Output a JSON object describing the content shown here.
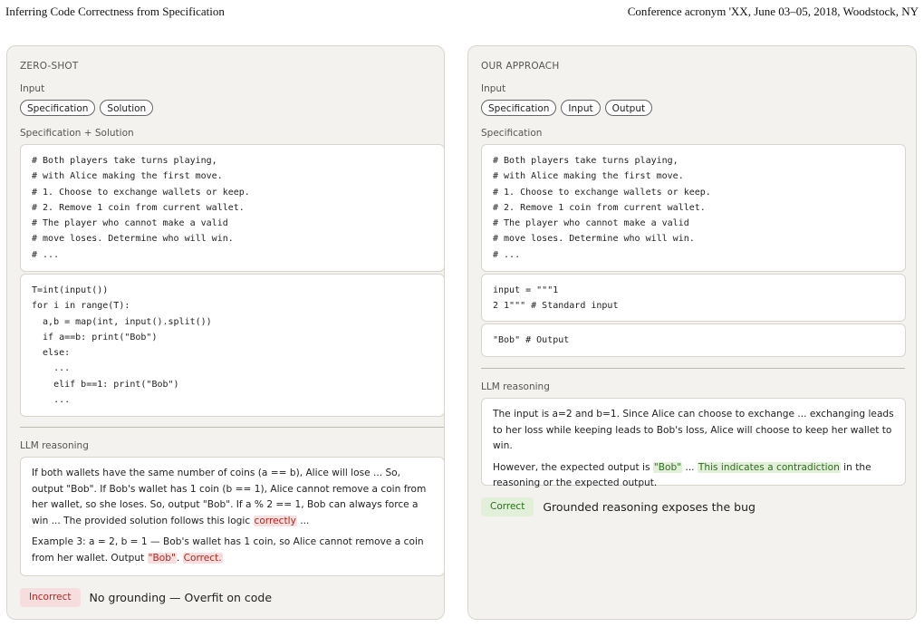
{
  "header": {
    "left": "Inferring Code Correctness from Specification",
    "right": "Conference acronym 'XX, June 03–05, 2018, Woodstock, NY"
  },
  "zero_shot": {
    "title": "ZERO-SHOT",
    "input_label": "Input",
    "pills": [
      "Specification",
      "Solution"
    ],
    "spec_label": "Specification + Solution",
    "spec_code": "# Both players take turns playing,\n# with Alice making the first move.\n# 1. Choose to exchange wallets or keep.\n# 2. Remove 1 coin from current wallet.\n# The player who cannot make a valid\n# move loses. Determine who will win.\n# ...",
    "solution_code": "T=int(input())\nfor i in range(T):\n  a,b = map(int, input().split())\n  if a==b: print(\"Bob\")\n  else:\n    ...\n    elif b==1: print(\"Bob\")\n    ...",
    "reasoning_label": "LLM reasoning",
    "reasoning_p1_a": "If both wallets have the same number of coins (a == b), Alice will lose ... So, output \"Bob\". If Bob's wallet has 1 coin (b == 1), Alice cannot remove a coin from her wallet, so she loses. So, output \"Bob\". If a % 2 == 1, Bob can always force a win ... The provided solution follows this logic ",
    "reasoning_p1_hl": "correctly",
    "reasoning_p1_b": " ...",
    "reasoning_p2_a": "Example 3: a = 2, b = 1 — Bob's wallet has 1 coin, so Alice cannot remove a coin from her wallet. Output ",
    "reasoning_p2_hl1": "\"Bob\"",
    "reasoning_p2_sep": ". ",
    "reasoning_p2_hl2": "Correct.",
    "verdict_badge": "Incorrect",
    "verdict_text": "No grounding — Overfit on code"
  },
  "our_approach": {
    "title": "OUR APPROACH",
    "input_label": "Input",
    "pills": [
      "Specification",
      "Input",
      "Output"
    ],
    "spec_label": "Specification",
    "spec_code": "# Both players take turns playing,\n# with Alice making the first move.\n# 1. Choose to exchange wallets or keep.\n# 2. Remove 1 coin from current wallet.\n# The player who cannot make a valid\n# move loses. Determine who will win.\n# ...",
    "input_code": "input = \"\"\"1\n2 1\"\"\" # Standard input",
    "output_code": "\"Bob\" # Output",
    "reasoning_label": "LLM reasoning",
    "reasoning_p1": "The input is a=2 and b=1. Since Alice can choose to exchange ... exchanging leads to her loss while keeping leads to Bob's loss, Alice will choose to keep her wallet to win.",
    "reasoning_p2_a": "However, the expected output is ",
    "reasoning_p2_hl1": "\"Bob\"",
    "reasoning_p2_mid": " ... ",
    "reasoning_p2_hl2": "This indicates a contradiction",
    "reasoning_p2_b": " in the reasoning or the expected output.",
    "verdict_badge": "Correct",
    "verdict_text": "Grounded reasoning exposes the bug"
  }
}
